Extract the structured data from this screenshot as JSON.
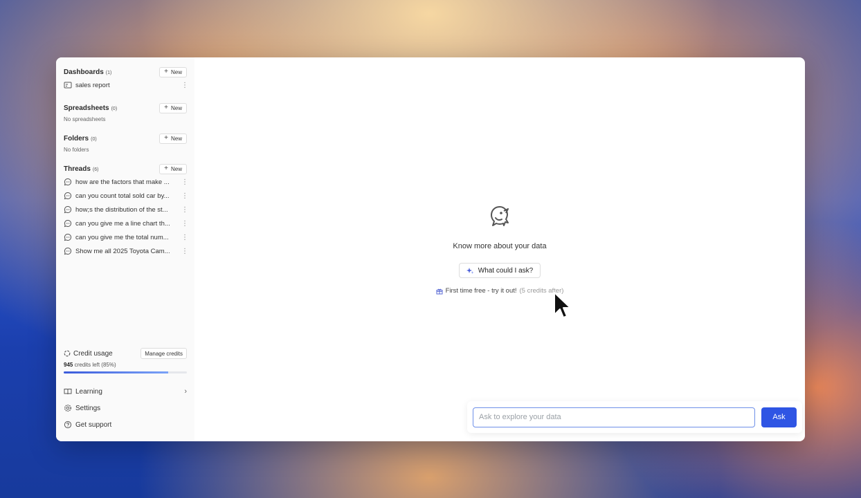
{
  "sidebar": {
    "dashboards": {
      "title": "Dashboards",
      "count": "(1)",
      "new_label": "New",
      "items": [
        {
          "label": "sales report"
        }
      ]
    },
    "spreadsheets": {
      "title": "Spreadsheets",
      "count": "(0)",
      "new_label": "New",
      "empty": "No spreadsheets"
    },
    "folders": {
      "title": "Folders",
      "count": "(0)",
      "new_label": "New",
      "empty": "No folders"
    },
    "threads": {
      "title": "Threads",
      "count": "(6)",
      "new_label": "New",
      "items": [
        {
          "label": "how are the factors that make ..."
        },
        {
          "label": "can you count total sold car by..."
        },
        {
          "label": "how;s the distribution of the st..."
        },
        {
          "label": "can you give me a line chart th..."
        },
        {
          "label": "can you give me the total num..."
        },
        {
          "label": "Show me all 2025 Toyota Cam..."
        }
      ]
    },
    "credit": {
      "title": "Credit usage",
      "manage_label": "Manage credits",
      "credits_value": "945",
      "credits_suffix": "credits left (85%)",
      "percent_left": 85
    },
    "nav": {
      "learning": "Learning",
      "settings": "Settings",
      "support": "Get support"
    }
  },
  "main": {
    "hero_title": "Know more about your data",
    "suggest_button": "What could I ask?",
    "free_text": "First time free - try it out!",
    "free_muted": "(5 credits after)",
    "input_placeholder": "Ask to explore your data",
    "ask_button": "Ask"
  },
  "colors": {
    "accent": "#2f55e4",
    "progress_start": "#3b5bdb",
    "progress_end": "#7aa2f7"
  },
  "icons": {
    "dashboard": "dashboard-icon",
    "thread": "chat-bubble-icon",
    "credit": "spinner-icon",
    "learning": "book-icon",
    "settings": "gear-icon",
    "support": "help-circle-icon",
    "hero": "bird-logo-icon",
    "suggest": "sparkle-icon",
    "gift": "gift-icon"
  }
}
